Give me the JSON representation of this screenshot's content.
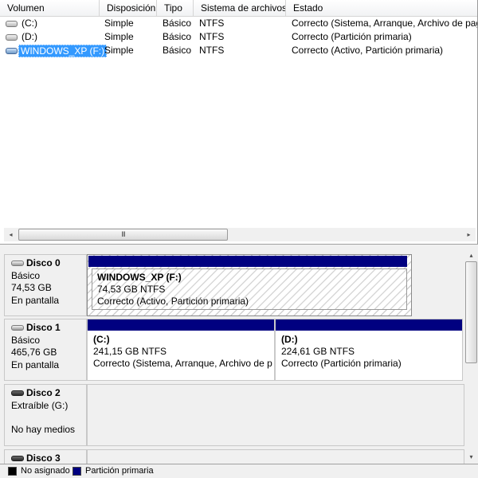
{
  "columns": [
    "Volumen",
    "Disposición",
    "Tipo",
    "Sistema de archivos",
    "Estado"
  ],
  "volumes": [
    {
      "name": "(C:)",
      "layout": "Simple",
      "type": "Básico",
      "fs": "NTFS",
      "status": "Correcto (Sistema, Arranque, Archivo de pag"
    },
    {
      "name": "(D:)",
      "layout": "Simple",
      "type": "Básico",
      "fs": "NTFS",
      "status": "Correcto (Partición primaria)"
    },
    {
      "name": "WINDOWS_XP (F:)",
      "layout": "Simple",
      "type": "Básico",
      "fs": "NTFS",
      "status": "Correcto (Activo, Partición primaria)",
      "selected": true
    }
  ],
  "hscroll": {
    "left_arrow": "◂",
    "right_arrow": "▸",
    "grip": "III"
  },
  "vscroll": {
    "up_arrow": "▴",
    "down_arrow": "▾"
  },
  "disks": [
    {
      "name": "Disco 0",
      "kind": "Básico",
      "size": "74,53 GB",
      "state": "En pantalla",
      "partitions": [
        {
          "title": "WINDOWS_XP  (F:)",
          "size_fs": "74,53 GB NTFS",
          "status": "Correcto (Activo, Partición primaria)"
        }
      ]
    },
    {
      "name": "Disco 1",
      "kind": "Básico",
      "size": "465,76 GB",
      "state": "En pantalla",
      "partitions": [
        {
          "title": "(C:)",
          "size_fs": "241,15 GB NTFS",
          "status": "Correcto (Sistema, Arranque, Archivo de p"
        },
        {
          "title": "(D:)",
          "size_fs": "224,61 GB NTFS",
          "status": "Correcto (Partición primaria)"
        }
      ]
    },
    {
      "name": "Disco 2",
      "kind": "Extraíble (G:)",
      "state": "No hay medios"
    },
    {
      "name": "Disco 3"
    }
  ],
  "legend": [
    {
      "label": "No asignado",
      "color": "#000000"
    },
    {
      "label": "Partición primaria",
      "color": "#000080"
    }
  ],
  "colors": {
    "partition_bar": "#000080",
    "selection": "#3399ff"
  }
}
